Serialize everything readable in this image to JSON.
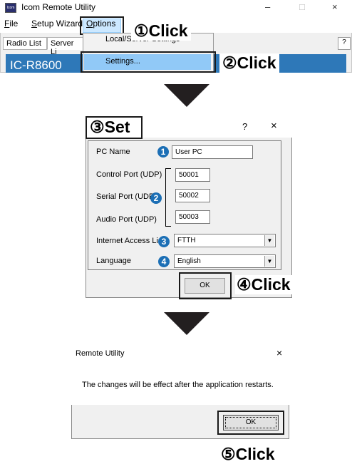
{
  "screen1": {
    "app_icon_text": "Icom",
    "window_title": "Icom Remote Utility",
    "window_controls": {
      "minimize": "–",
      "maximize": "□",
      "close": "×"
    },
    "menu": [
      {
        "label": "File",
        "underline": "F",
        "rest": "ile"
      },
      {
        "label": "Setup Wizard",
        "underline": "S",
        "rest": "etup Wizard"
      },
      {
        "label": "Options",
        "underline": "O",
        "rest": "ptions"
      }
    ],
    "tabs": [
      "Radio List",
      "Server Li"
    ],
    "help_button": "?",
    "dropdown_items": [
      "Local/Server Settings",
      "Settings..."
    ],
    "radio_name": "IC-R8600",
    "callouts": [
      "①Click",
      "②Click"
    ]
  },
  "screen2": {
    "callout_set": "③Set",
    "help": "?",
    "close": "×",
    "labels": {
      "pc_name": "PC Name",
      "control_port": "Control Port (UDP)",
      "serial_port": "Serial Port (UDP)",
      "audio_port": "Audio Port (UDP)",
      "internet_access": "Internet Access Lin",
      "language": "Language"
    },
    "values": {
      "pc_name": "User PC",
      "control_port": "50001",
      "serial_port": "50002",
      "audio_port": "50003",
      "internet_access": "FTTH",
      "language": "English"
    },
    "step_numbers": [
      "1",
      "2",
      "3",
      "4"
    ],
    "ok_label": "OK",
    "callout_click": "④Click"
  },
  "screen3": {
    "title": "Remote Utility",
    "close": "×",
    "message": "The changes will be effect after the application restarts.",
    "ok_label": "OK",
    "callout_click": "⑤Click"
  },
  "colors": {
    "accent_blue": "#1c6fb5",
    "panel_blue": "#2e78b8",
    "arrow": "#231f20"
  }
}
